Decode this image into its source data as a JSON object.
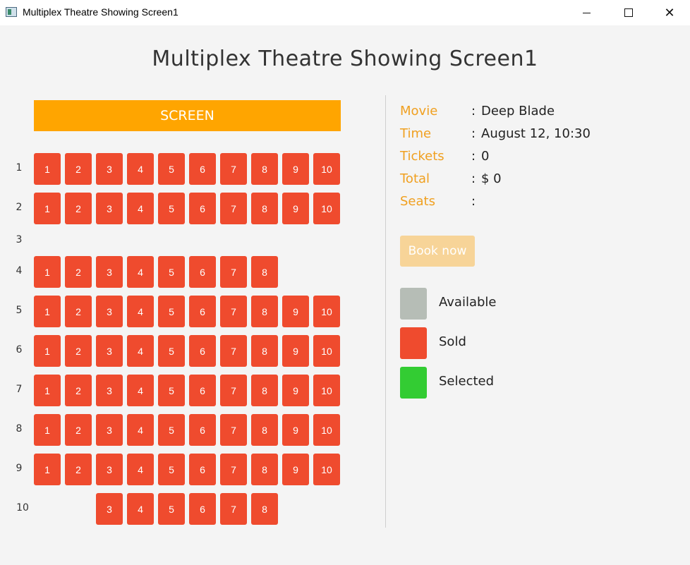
{
  "window": {
    "title": "Multiplex Theatre Showing Screen1"
  },
  "page": {
    "title": "Multiplex Theatre Showing Screen1",
    "screen_label": "SCREEN"
  },
  "rows": [
    {
      "label": "1",
      "seats": [
        "1",
        "2",
        "3",
        "4",
        "5",
        "6",
        "7",
        "8",
        "9",
        "10"
      ]
    },
    {
      "label": "2",
      "seats": [
        "1",
        "2",
        "3",
        "4",
        "5",
        "6",
        "7",
        "8",
        "9",
        "10"
      ]
    },
    {
      "label": "3",
      "seats": []
    },
    {
      "label": "4",
      "seats": [
        "1",
        "2",
        "3",
        "4",
        "5",
        "6",
        "7",
        "8"
      ]
    },
    {
      "label": "5",
      "seats": [
        "1",
        "2",
        "3",
        "4",
        "5",
        "6",
        "7",
        "8",
        "9",
        "10"
      ]
    },
    {
      "label": "6",
      "seats": [
        "1",
        "2",
        "3",
        "4",
        "5",
        "6",
        "7",
        "8",
        "9",
        "10"
      ]
    },
    {
      "label": "7",
      "seats": [
        "1",
        "2",
        "3",
        "4",
        "5",
        "6",
        "7",
        "8",
        "9",
        "10"
      ]
    },
    {
      "label": "8",
      "seats": [
        "1",
        "2",
        "3",
        "4",
        "5",
        "6",
        "7",
        "8",
        "9",
        "10"
      ]
    },
    {
      "label": "9",
      "seats": [
        "1",
        "2",
        "3",
        "4",
        "5",
        "6",
        "7",
        "8",
        "9",
        "10"
      ]
    },
    {
      "label": "10",
      "seats": [
        "3",
        "4",
        "5",
        "6",
        "7",
        "8"
      ]
    }
  ],
  "info": [
    {
      "key": "movie",
      "label": "Movie",
      "colon": ":",
      "value": "Deep Blade"
    },
    {
      "key": "time",
      "label": "Time",
      "colon": ":",
      "value": "August 12, 10:30"
    },
    {
      "key": "tickets",
      "label": "Tickets",
      "colon": ":",
      "value": "0"
    },
    {
      "key": "total",
      "label": "Total",
      "colon": ":",
      "value": "$ 0"
    },
    {
      "key": "seats",
      "label": "Seats",
      "colon": ":",
      "value": ""
    }
  ],
  "book_button": {
    "label": "Book now"
  },
  "legend": [
    {
      "key": "available",
      "label": "Available",
      "color": "#b6bdb6"
    },
    {
      "key": "sold",
      "label": "Sold",
      "color": "#ef4b2e"
    },
    {
      "key": "selected",
      "label": "Selected",
      "color": "#33cc33"
    }
  ],
  "colors": {
    "seat_sold": "#ef4b2e",
    "screen": "#ffa500",
    "label_accent": "#f0a020",
    "book_disabled": "#f7d498"
  }
}
